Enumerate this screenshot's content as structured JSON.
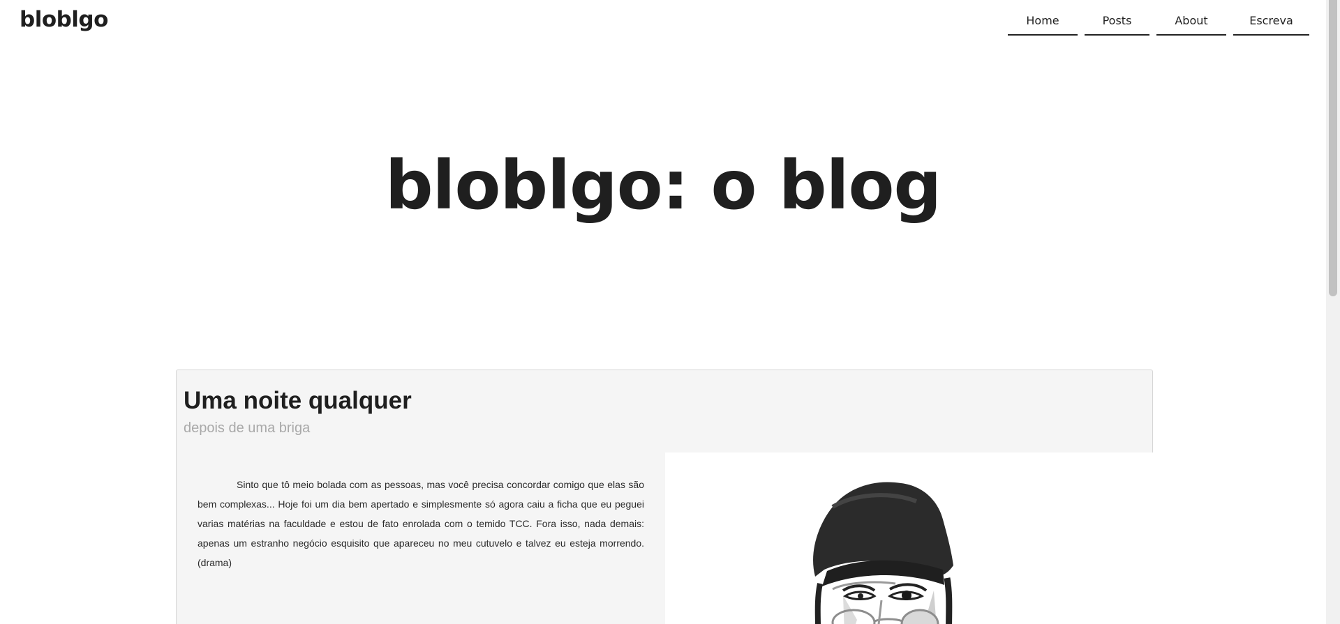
{
  "header": {
    "logo": "bloblgo",
    "nav": [
      {
        "label": "Home"
      },
      {
        "label": "Posts"
      },
      {
        "label": "About"
      },
      {
        "label": "Escreva"
      }
    ]
  },
  "hero": {
    "title": "bloblgo: o blog"
  },
  "post": {
    "title": "Uma noite qualquer",
    "subtitle": "depois de uma briga",
    "body": "Sinto que tô meio bolada com as pessoas, mas você precisa concordar comigo que elas são bem complexas... Hoje foi um dia bem apertado e simplesmente só agora caiu a ficha que eu peguei varias matérias na faculdade e estou de fato enrolada com o temido TCC. Fora isso, nada demais: apenas um estranho negócio esquisito que apareceu no meu cutuvelo e talvez eu esteja morrendo. (drama)",
    "image_icon": "portrait-illustration"
  }
}
